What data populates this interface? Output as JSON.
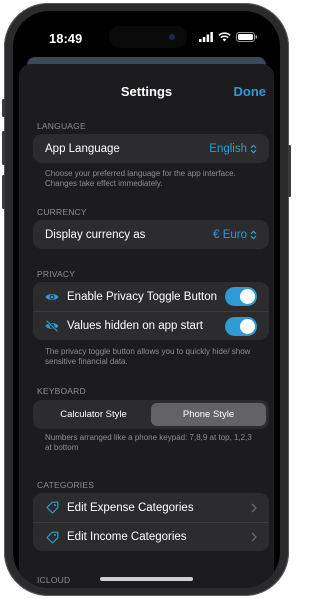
{
  "status": {
    "time": "18:49"
  },
  "nav": {
    "title": "Settings",
    "done_label": "Done"
  },
  "language": {
    "section_label": "LANGUAGE",
    "row_label": "App Language",
    "value": "English",
    "footnote": "Choose your preferred language for the app interface. Changes take effect immediately."
  },
  "currency": {
    "section_label": "CURRENCY",
    "row_label": "Display currency as",
    "value": "€ Euro"
  },
  "privacy": {
    "section_label": "PRIVACY",
    "rows": [
      {
        "label": "Enable Privacy Toggle Button",
        "icon": "eye-icon",
        "on": true
      },
      {
        "label": "Values hidden on app start",
        "icon": "eye-slash-icon",
        "on": true
      }
    ],
    "footnote": "The privacy toggle button allows you to quickly hide/ show sensitive financial data."
  },
  "keyboard": {
    "section_label": "KEYBOARD",
    "options": [
      "Calculator Style",
      "Phone Style"
    ],
    "selected": "Phone Style",
    "footnote": "Numbers arranged like a phone keypad: 7,8,9 at top, 1,2,3 at bottom"
  },
  "categories": {
    "section_label": "CATEGORIES",
    "rows": [
      {
        "label": "Edit Expense Categories",
        "icon": "tag-icon"
      },
      {
        "label": "Edit Income Categories",
        "icon": "tag-icon"
      }
    ]
  },
  "icloud": {
    "section_label": "ICLOUD"
  },
  "colors": {
    "accent": "#2f9bd6",
    "background": "#1c1c1e",
    "card": "#2c2c2e",
    "secondary_text": "#8e8e93"
  }
}
